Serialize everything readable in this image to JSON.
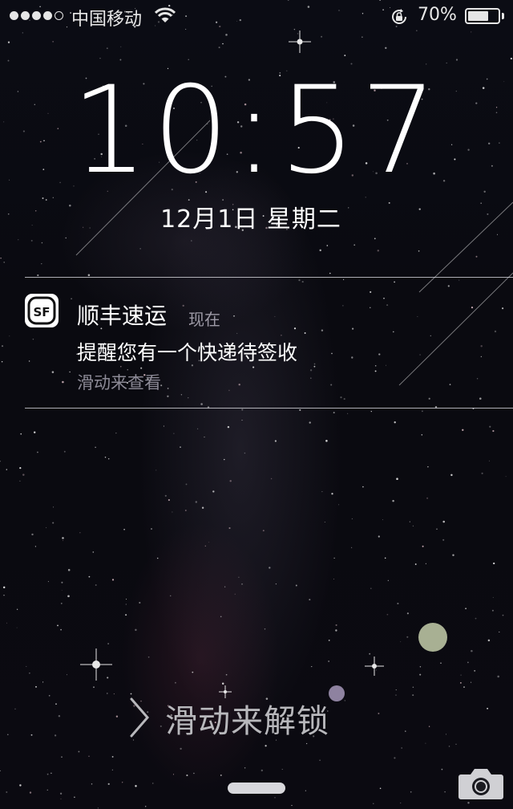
{
  "status_bar": {
    "signal_bars_filled": 4,
    "signal_bars_total": 5,
    "carrier": "中国移动",
    "battery_percent": "70%",
    "battery_level": 0.7
  },
  "lock_screen": {
    "time": "10:57",
    "date": "12月1日  星期二",
    "unlock_label": "滑动来解锁"
  },
  "notification": {
    "app_name": "顺丰速运",
    "app_icon": "sf-express-logo",
    "time_label": "现在",
    "message": "提醒您有一个快递待签收",
    "action_hint": "滑动来查看"
  },
  "icons": {
    "wifi": "wifi-icon",
    "rotation_lock": "rotation-lock-icon",
    "battery": "battery-icon",
    "chevron": "chevron-right-icon",
    "camera": "camera-icon"
  },
  "colors": {
    "background": "#0b0c14",
    "secondary_text": "#9d9aa6",
    "unlock_text": "#b8b8bc"
  }
}
